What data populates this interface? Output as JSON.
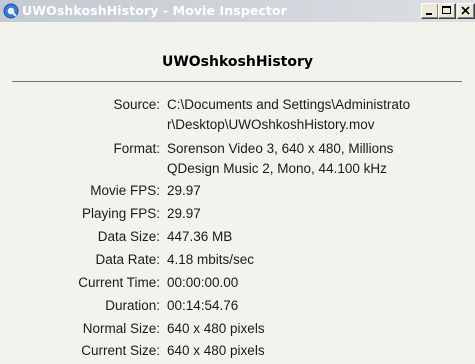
{
  "window": {
    "title": "UWOshkoshHistory - Movie Inspector",
    "buttons": {
      "minimize": "minimize",
      "maximize": "maximize",
      "close": "close"
    }
  },
  "heading": "UWOshkoshHistory",
  "info": {
    "source_label": "Source:",
    "source_value_line1": "C:\\Documents and Settings\\Administrato",
    "source_value_line2": "r\\Desktop\\UWOshkoshHistory.mov",
    "format_label": "Format:",
    "format_value_line1": "Sorenson Video 3, 640 x 480, Millions",
    "format_value_line2": "QDesign Music 2, Mono, 44.100 kHz",
    "movie_fps_label": "Movie FPS:",
    "movie_fps_value": "29.97",
    "playing_fps_label": "Playing FPS:",
    "playing_fps_value": "29.97",
    "data_size_label": "Data Size:",
    "data_size_value": "447.36 MB",
    "data_rate_label": "Data Rate:",
    "data_rate_value": "4.18 mbits/sec",
    "current_time_label": "Current Time:",
    "current_time_value": "00:00:00.00",
    "duration_label": "Duration:",
    "duration_value": "00:14:54.76",
    "normal_size_label": "Normal Size:",
    "normal_size_value": "640 x 480 pixels",
    "current_size_label": "Current Size:",
    "current_size_value": "640 x 480 pixels"
  },
  "colors": {
    "title_text": "#ffffff",
    "background": "#f3f3ee",
    "divider": "#707070"
  },
  "icons": {
    "app": "quicktime-icon",
    "minimize": "minimize-icon",
    "maximize": "maximize-icon",
    "close": "close-icon"
  }
}
